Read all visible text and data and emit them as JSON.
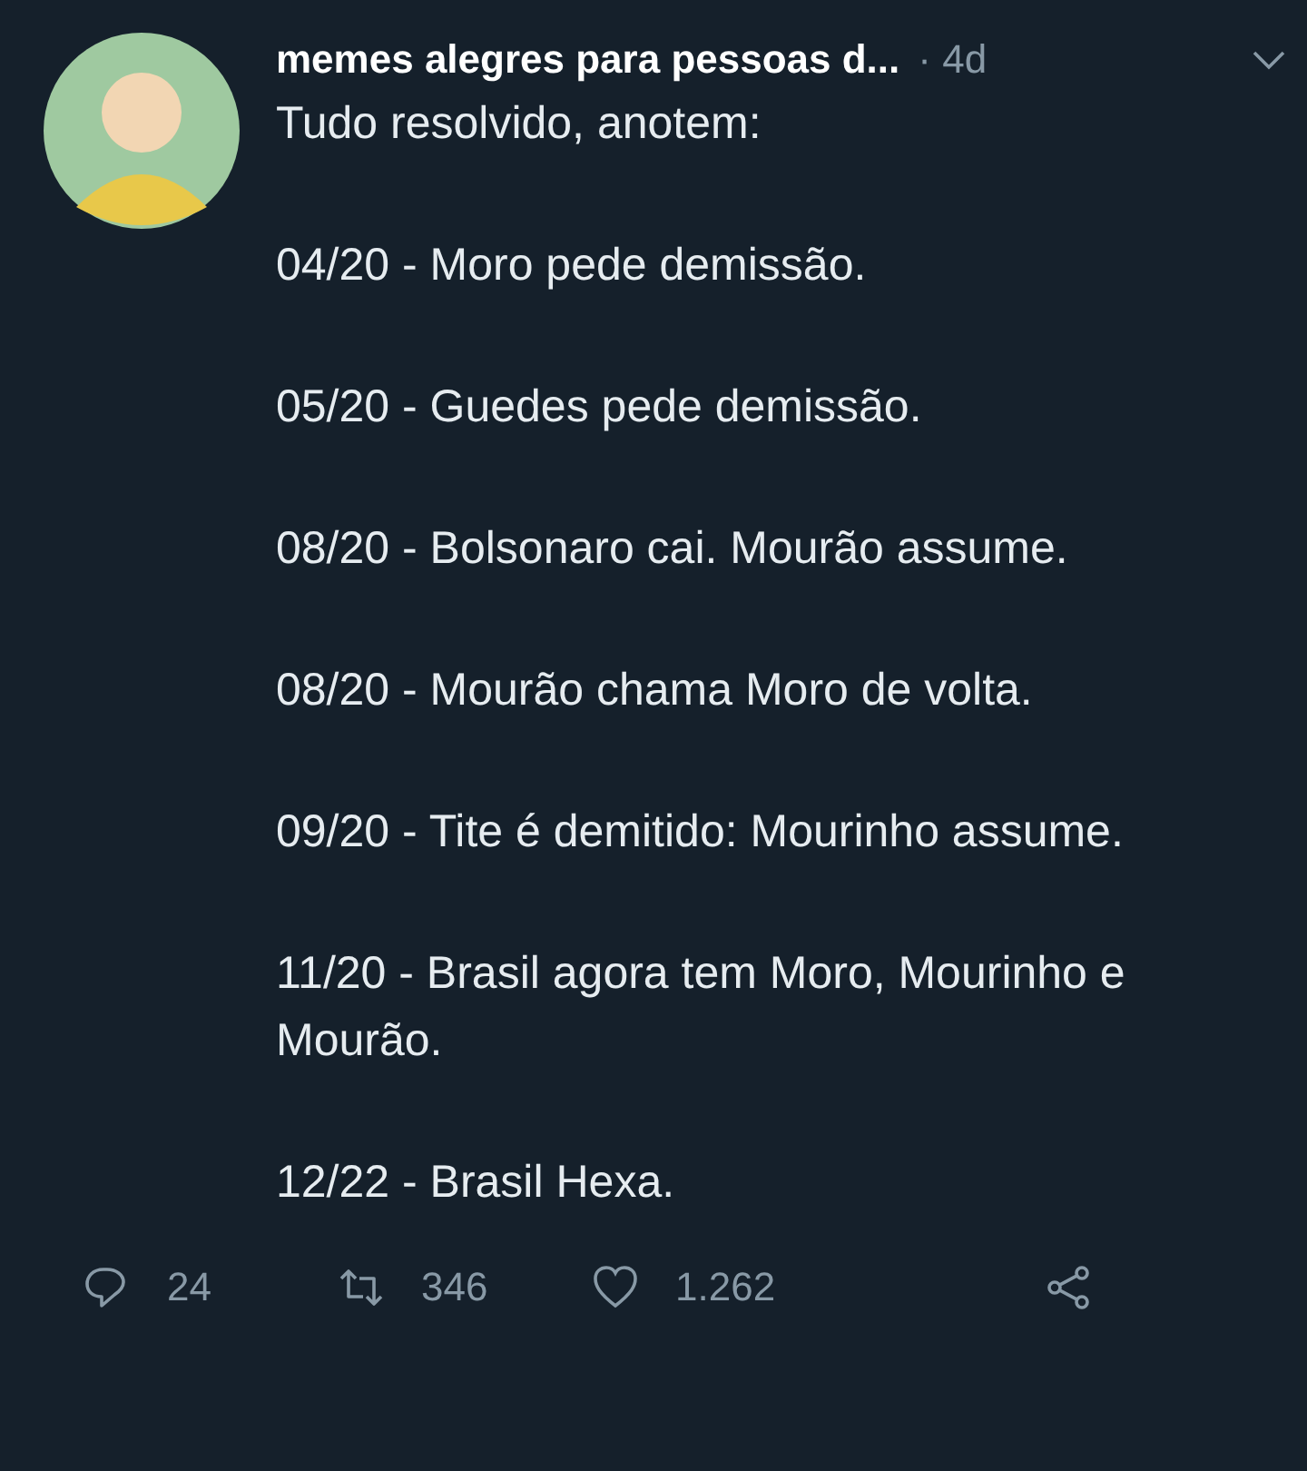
{
  "tweet": {
    "author": "memes alegres para pessoas d...",
    "age": "· 4d",
    "paragraphs": [
      "Tudo resolvido, anotem:",
      "04/20 - Moro pede demissão.",
      "05/20 - Guedes pede demissão.",
      "08/20 - Bolsonaro cai. Mourão assume.",
      "08/20 - Mourão chama Moro de volta.",
      "09/20 - Tite é demitido: Mourinho assume.",
      "11/20 - Brasil agora tem Moro, Mourinho e Mourão.",
      "12/22 - Brasil Hexa."
    ],
    "actions": [
      {
        "kind": "reply",
        "count": "24"
      },
      {
        "kind": "retweet",
        "count": "346"
      },
      {
        "kind": "like",
        "count": "1.262"
      },
      {
        "kind": "share"
      }
    ]
  }
}
